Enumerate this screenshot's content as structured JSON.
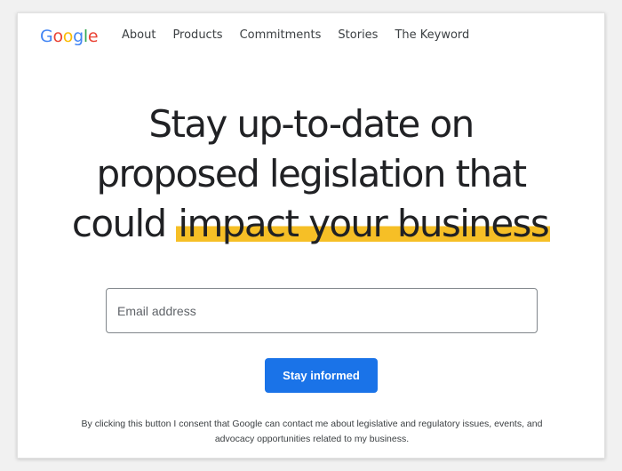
{
  "nav": {
    "logo": {
      "letters": [
        "G",
        "o",
        "o",
        "g",
        "l",
        "e"
      ],
      "colors": [
        "#4285f4",
        "#ea4335",
        "#fbbc05",
        "#4285f4",
        "#34a853",
        "#ea4335"
      ]
    },
    "links": [
      "About",
      "Products",
      "Commitments",
      "Stories",
      "The Keyword"
    ]
  },
  "hero": {
    "line1": "Stay up-to-date on",
    "line2": "proposed legislation that",
    "line3_plain": "could",
    "line3_highlight": "impact your business",
    "highlight_color": "#f6bf26"
  },
  "form": {
    "email_placeholder": "Email address",
    "email_value": "",
    "submit_label": "Stay informed",
    "button_color": "#1a73e8"
  },
  "consent": {
    "text": "By clicking this button I consent that Google can contact me about legislative and regulatory issues, events, and advocacy opportunities related to my business."
  }
}
